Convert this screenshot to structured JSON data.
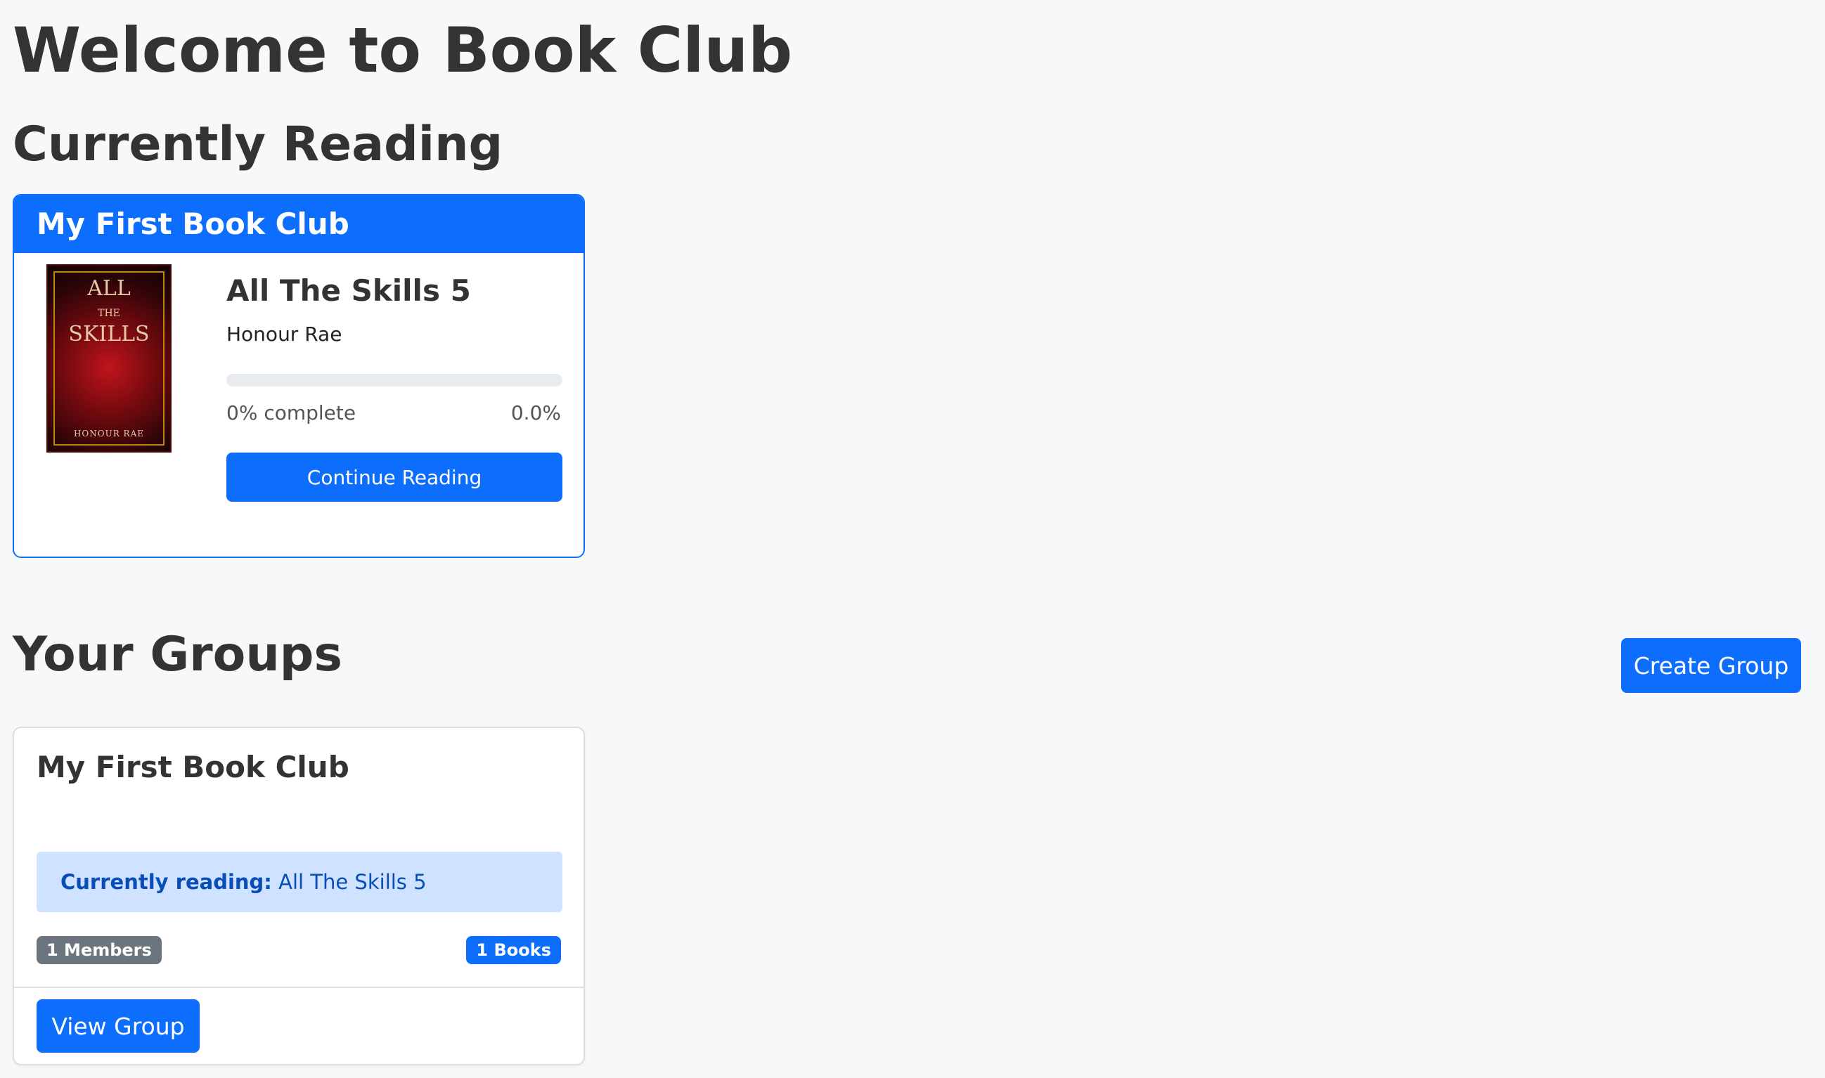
{
  "page": {
    "title": "Welcome to Book Club"
  },
  "currently_reading": {
    "heading": "Currently Reading",
    "group_name": "My First Book Club",
    "book": {
      "title": "All The Skills 5",
      "author": "Honour Rae",
      "cover_title": "ALL THE SKILLS",
      "cover_author": "HONOUR RAE",
      "progress_fraction": 0,
      "progress_label": "0% complete",
      "progress_value": "0.0%"
    },
    "continue_label": "Continue Reading"
  },
  "groups": {
    "heading": "Your Groups",
    "create_label": "Create Group",
    "items": [
      {
        "name": "My First Book Club",
        "current_prefix": "Currently reading:",
        "current_book": "All The Skills 5",
        "members_badge": "1 Members",
        "books_badge": "1 Books",
        "view_label": "View Group"
      }
    ]
  },
  "colors": {
    "primary": "#0d6efd",
    "background": "#f7f8fa",
    "badge_gray": "#6c757d",
    "info_box": "#cfe2ff"
  }
}
